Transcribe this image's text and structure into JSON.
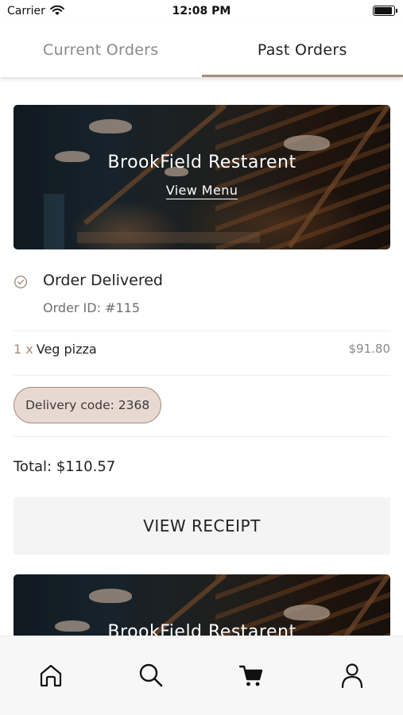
{
  "status_bar": {
    "carrier": "Carrier",
    "time": "12:08 PM",
    "wifi_icon": "wifi-icon",
    "battery_icon": "battery-icon"
  },
  "tabs": [
    {
      "label": "Current Orders",
      "active": false
    },
    {
      "label": "Past Orders",
      "active": true
    }
  ],
  "orders": [
    {
      "restaurant_name": "BrookField Restarent",
      "view_menu_label": "View Menu",
      "status": "Order Delivered",
      "status_icon": "check-circle-icon",
      "order_id": "Order ID: #115",
      "items": [
        {
          "qty": "1 x",
          "name": "Veg pizza",
          "price": "$91.80"
        }
      ],
      "delivery_code": "Delivery code: 2368",
      "total": "Total: $110.57",
      "receipt_button_label": "VIEW RECEIPT"
    },
    {
      "restaurant_name": "BrookField Restarent"
    }
  ],
  "bottom_nav": [
    {
      "name": "home",
      "icon": "home-icon"
    },
    {
      "name": "search",
      "icon": "search-icon"
    },
    {
      "name": "cart",
      "icon": "cart-icon"
    },
    {
      "name": "profile",
      "icon": "user-icon"
    }
  ],
  "colors": {
    "accent": "#a58e7f",
    "badge_bg": "#e8d9d0",
    "button_bg": "#f4f4f4",
    "nav_bg": "#f7f7f7"
  }
}
